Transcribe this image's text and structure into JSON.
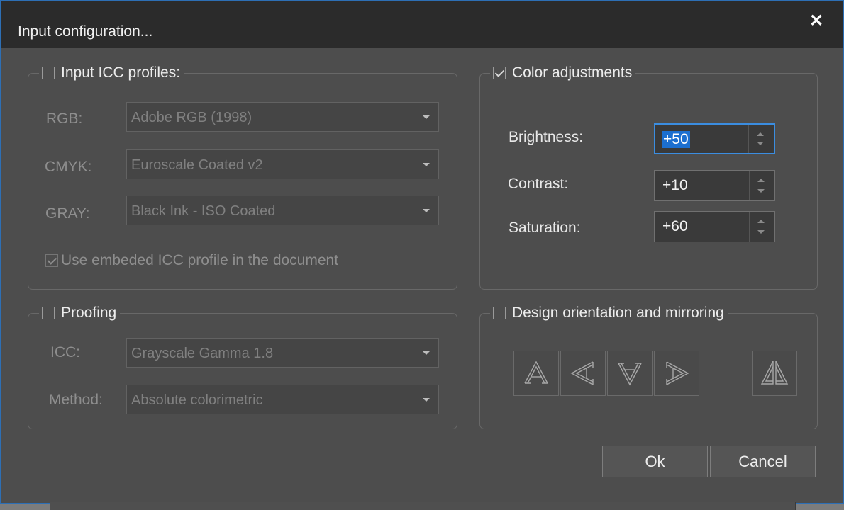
{
  "window": {
    "title": "Input configuration...",
    "close_glyph": "✕"
  },
  "icc_group": {
    "label": "Input ICC profiles:",
    "checked": false,
    "rows": [
      {
        "label": "RGB:",
        "value": "Adobe RGB (1998)"
      },
      {
        "label": "CMYK:",
        "value": "Euroscale Coated v2"
      },
      {
        "label": "GRAY:",
        "value": "Black Ink - ISO Coated"
      }
    ],
    "embedded": {
      "label": "Use embeded ICC profile in the document",
      "checked": true
    }
  },
  "color_group": {
    "label": "Color adjustments",
    "checked": true,
    "fields": [
      {
        "label": "Brightness:",
        "value": "+50"
      },
      {
        "label": "Contrast:",
        "value": "+10"
      },
      {
        "label": "Saturation:",
        "value": "+60"
      }
    ]
  },
  "proofing_group": {
    "label": "Proofing",
    "checked": false,
    "rows": [
      {
        "label": "ICC:",
        "value": "Grayscale Gamma 1.8"
      },
      {
        "label": "Method:",
        "value": "Absolute colorimetric"
      }
    ]
  },
  "orientation_group": {
    "label": "Design orientation and mirroring",
    "checked": false,
    "icons": [
      "rotate-0-icon",
      "rotate-90-left-icon",
      "rotate-180-icon",
      "rotate-90-right-icon",
      "mirror-icon"
    ]
  },
  "buttons": {
    "ok": "Ok",
    "cancel": "Cancel"
  },
  "colors": {
    "accent": "#3b8de0",
    "selection": "#1c6fd0",
    "dialog_bg": "#4d4d4d",
    "titlebar_bg": "#2b2b2b"
  }
}
